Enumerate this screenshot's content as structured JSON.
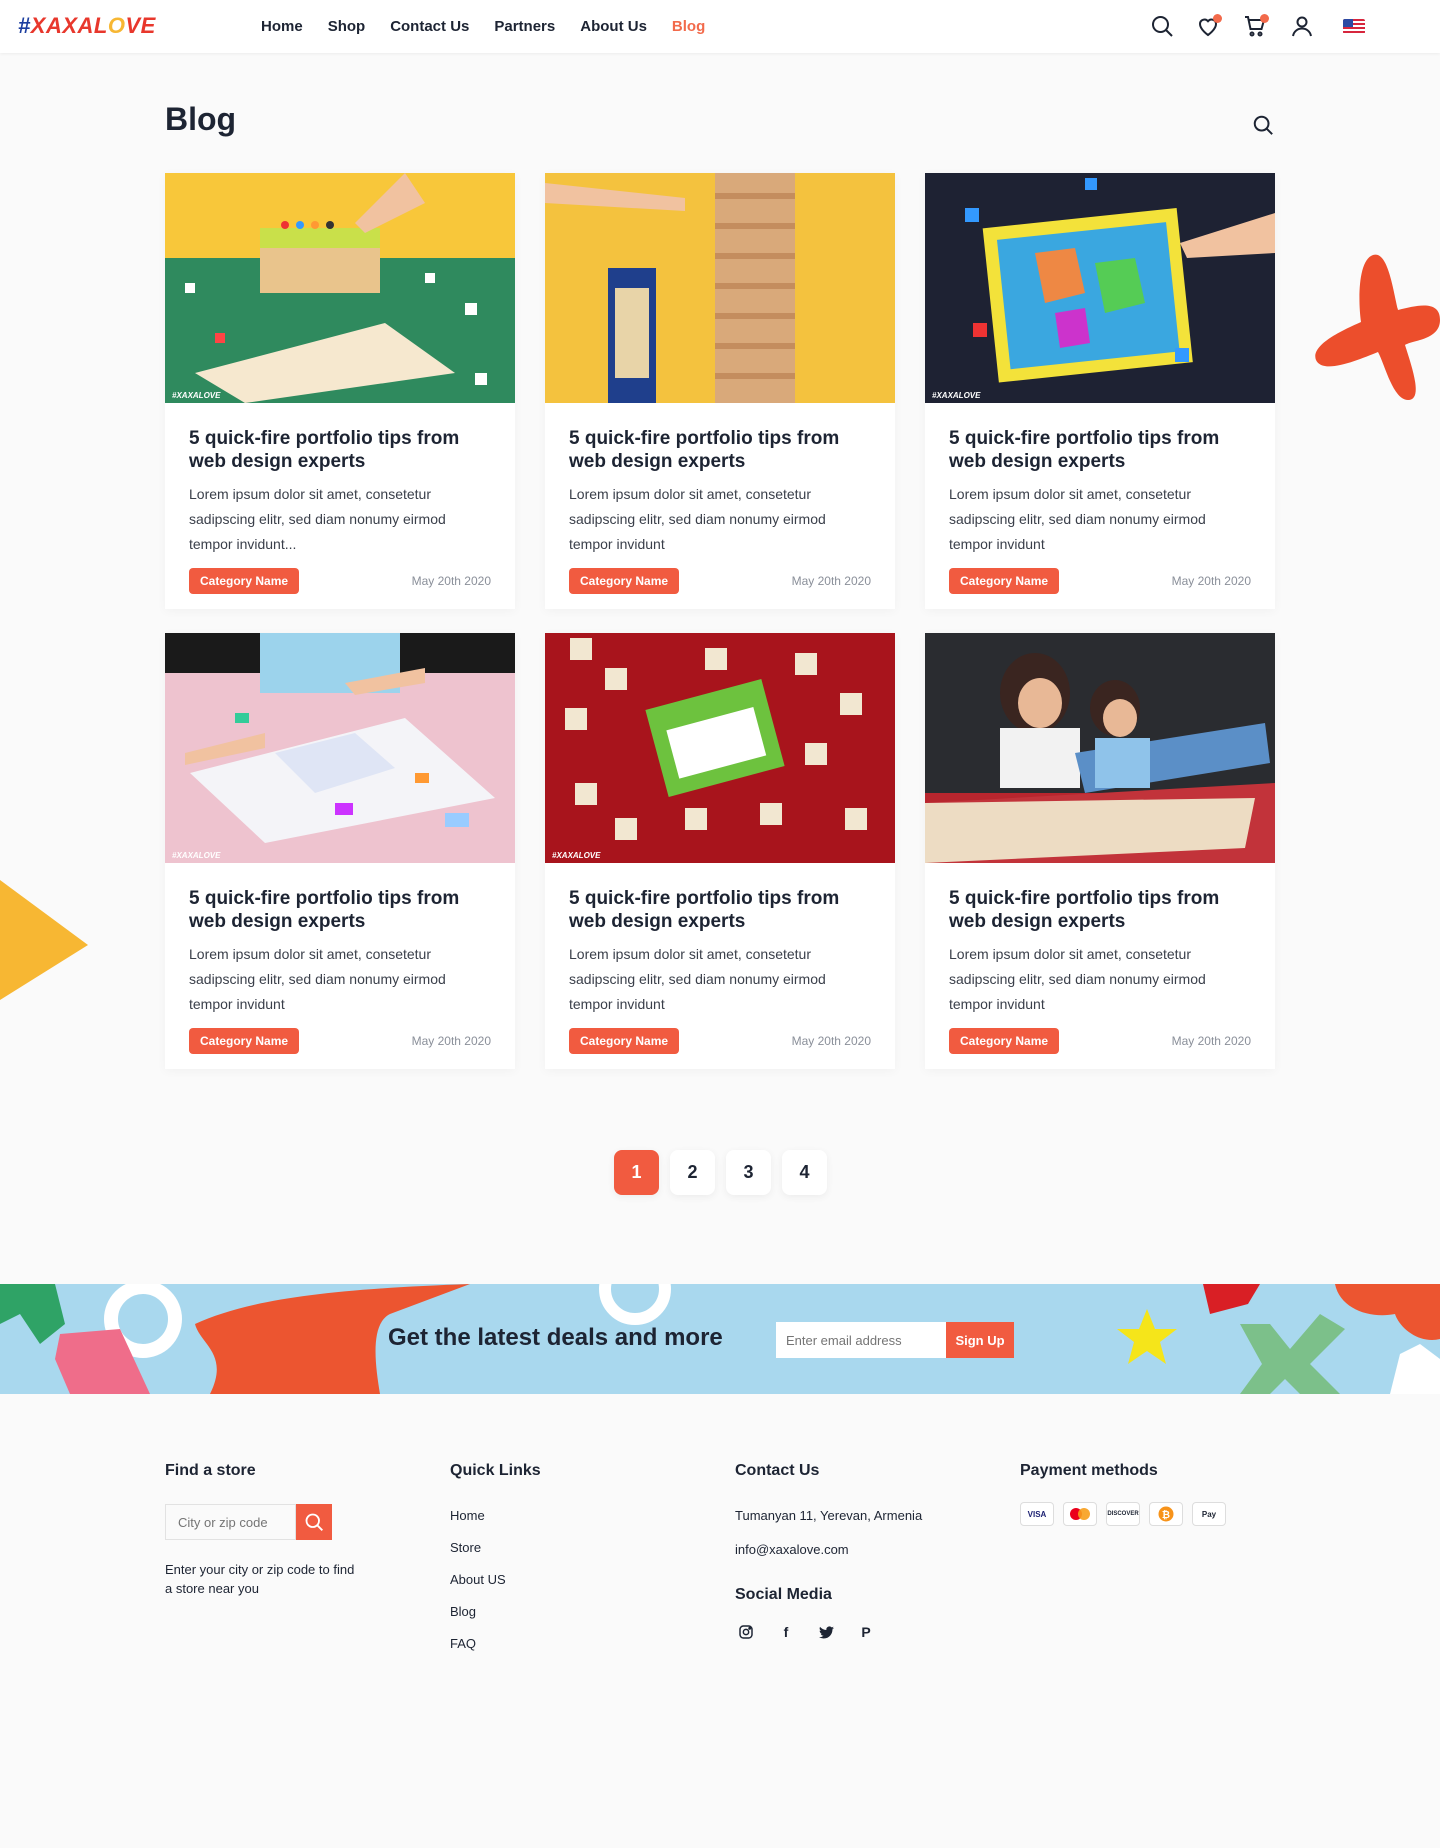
{
  "header": {
    "logo": "#XAXALOVE",
    "nav": [
      "Home",
      "Shop",
      "Contact Us",
      "Partners",
      "About Us",
      "Blog"
    ],
    "active_nav": "Blog",
    "icons": [
      "search-icon",
      "heart-icon",
      "cart-icon",
      "user-icon",
      "us-flag-icon"
    ]
  },
  "page": {
    "title": "Blog"
  },
  "posts": [
    {
      "title": "5 quick-fire portfolio tips from web design experts",
      "excerpt": "Lorem ipsum dolor sit amet, consetetur sadipscing elitr, sed diam nonumy eirmod tempor invidunt...",
      "category": "Category Name",
      "date": "May 20th 2020",
      "watermark": "#XAXALOVE"
    },
    {
      "title": "5 quick-fire portfolio tips from web design experts",
      "excerpt": "Lorem ipsum dolor sit amet, consetetur sadipscing elitr, sed diam nonumy eirmod tempor invidunt",
      "category": "Category Name",
      "date": "May 20th 2020",
      "watermark": ""
    },
    {
      "title": "5 quick-fire portfolio tips from web design experts",
      "excerpt": "Lorem ipsum dolor sit amet, consetetur sadipscing elitr, sed diam nonumy eirmod tempor invidunt",
      "category": "Category Name",
      "date": "May 20th 2020",
      "watermark": "#XAXALOVE"
    },
    {
      "title": "5 quick-fire portfolio tips from web design experts",
      "excerpt": "Lorem ipsum dolor sit amet, consetetur sadipscing elitr, sed diam nonumy eirmod tempor invidunt",
      "category": "Category Name",
      "date": "May 20th 2020",
      "watermark": "#XAXALOVE"
    },
    {
      "title": "5 quick-fire portfolio tips from web design experts",
      "excerpt": "Lorem ipsum dolor sit amet, consetetur sadipscing elitr, sed diam nonumy eirmod tempor invidunt",
      "category": "Category Name",
      "date": "May 20th 2020",
      "watermark": "#XAXALOVE"
    },
    {
      "title": "5 quick-fire portfolio tips from web design experts",
      "excerpt": "Lorem ipsum dolor sit amet, consetetur sadipscing elitr, sed diam nonumy eirmod tempor invidunt",
      "category": "Category Name",
      "date": "May 20th 2020",
      "watermark": ""
    }
  ],
  "pagination": {
    "pages": [
      "1",
      "2",
      "3",
      "4"
    ],
    "current": "1"
  },
  "newsletter": {
    "heading": "Get the latest deals and more",
    "placeholder": "Enter email address",
    "button": "Sign Up"
  },
  "footer": {
    "find_store": {
      "title": "Find a store",
      "placeholder": "City or zip code",
      "help": "Enter your city or zip code to find a store near you"
    },
    "quick_links": {
      "title": "Quick Links",
      "items": [
        "Home",
        "Store",
        "About US",
        "Blog",
        "FAQ"
      ]
    },
    "contact": {
      "title": "Contact Us",
      "address": "Tumanyan 11, Yerevan, Armenia",
      "email": "info@xaxalove.com"
    },
    "social": {
      "title": "Social Media",
      "icons": [
        "instagram-icon",
        "facebook-icon",
        "twitter-icon",
        "pinterest-icon"
      ]
    },
    "payment": {
      "title": "Payment methods",
      "methods": [
        "VISA",
        "Mastercard",
        "DISCOVER",
        "Bitcoin",
        "Pay"
      ]
    }
  },
  "colors": {
    "accent": "#f15b40",
    "newsletter_bg": "#a9d8ee",
    "text": "#1d2433"
  }
}
